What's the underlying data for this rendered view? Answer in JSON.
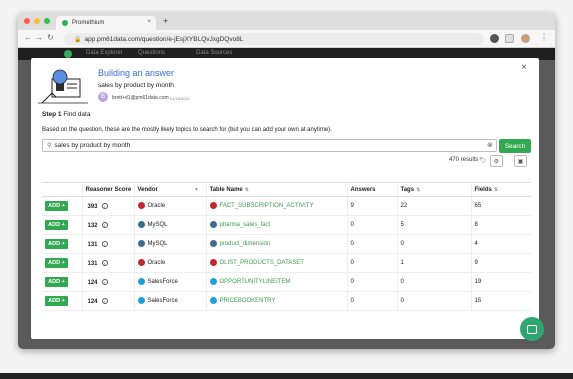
{
  "browser": {
    "tab_title": "Promethium",
    "tab_close": "×",
    "new_tab": "+",
    "url": "app.pm61data.com/question/e-jEsjXYBLQvJxgDQvo8L"
  },
  "app_nav": [
    "Data Explorer",
    "Questions",
    "Data Sources"
  ],
  "modal": {
    "close": "×",
    "title": "Building an answer",
    "subtitle": "sales by product by month",
    "author": "brett+d1@pm61data.com",
    "author_initial": "B",
    "date": "01/18/2021",
    "step_label": "Step 1",
    "step_text": "Find data",
    "intro": "Based on the question, these are the mostly likely topics to search for (but you can add your own at anytime).",
    "search_value": "sales by product by month",
    "search_button": "Search",
    "results": "470 results"
  },
  "table": {
    "headers": [
      "",
      "Reasoner Score",
      "Vendor",
      "Table Name",
      "Answers",
      "Tags",
      "Fields"
    ],
    "add_label": "ADD +",
    "rows": [
      {
        "score": "393",
        "vendor": "Oracle",
        "vendor_color": "#c0282d",
        "name": "FACT_SUBSCRIPTION_ACTIVITY",
        "answers": "9",
        "tags": "22",
        "fields": "65"
      },
      {
        "score": "132",
        "vendor": "MySQL",
        "vendor_color": "#3b6e8f",
        "name": "pharma_sales_fact",
        "answers": "0",
        "tags": "5",
        "fields": "8"
      },
      {
        "score": "131",
        "vendor": "MySQL",
        "vendor_color": "#3b6e8f",
        "name": "product_dimension",
        "answers": "0",
        "tags": "0",
        "fields": "4"
      },
      {
        "score": "131",
        "vendor": "Oracle",
        "vendor_color": "#c0282d",
        "name": "OLIST_PRODUCTS_DATASET",
        "answers": "0",
        "tags": "1",
        "fields": "9"
      },
      {
        "score": "124",
        "vendor": "SalesForce",
        "vendor_color": "#1ea0dc",
        "name": "OPPORTUNITYLINEITEM",
        "answers": "0",
        "tags": "0",
        "fields": "19"
      },
      {
        "score": "124",
        "vendor": "SalesForce",
        "vendor_color": "#1ea0dc",
        "name": "PRICEBOOKENTRY",
        "answers": "0",
        "tags": "0",
        "fields": "15"
      }
    ]
  },
  "colors": {
    "accent": "#33a852",
    "title_blue": "#3b6fd6"
  }
}
